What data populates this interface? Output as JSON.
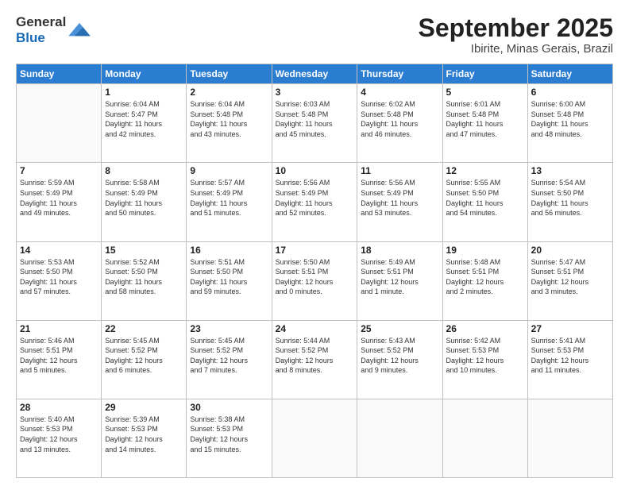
{
  "header": {
    "logo_general": "General",
    "logo_blue": "Blue",
    "month_title": "September 2025",
    "subtitle": "Ibirite, Minas Gerais, Brazil"
  },
  "weekdays": [
    "Sunday",
    "Monday",
    "Tuesday",
    "Wednesday",
    "Thursday",
    "Friday",
    "Saturday"
  ],
  "weeks": [
    [
      {
        "day": "",
        "info": ""
      },
      {
        "day": "1",
        "info": "Sunrise: 6:04 AM\nSunset: 5:47 PM\nDaylight: 11 hours\nand 42 minutes."
      },
      {
        "day": "2",
        "info": "Sunrise: 6:04 AM\nSunset: 5:48 PM\nDaylight: 11 hours\nand 43 minutes."
      },
      {
        "day": "3",
        "info": "Sunrise: 6:03 AM\nSunset: 5:48 PM\nDaylight: 11 hours\nand 45 minutes."
      },
      {
        "day": "4",
        "info": "Sunrise: 6:02 AM\nSunset: 5:48 PM\nDaylight: 11 hours\nand 46 minutes."
      },
      {
        "day": "5",
        "info": "Sunrise: 6:01 AM\nSunset: 5:48 PM\nDaylight: 11 hours\nand 47 minutes."
      },
      {
        "day": "6",
        "info": "Sunrise: 6:00 AM\nSunset: 5:48 PM\nDaylight: 11 hours\nand 48 minutes."
      }
    ],
    [
      {
        "day": "7",
        "info": "Sunrise: 5:59 AM\nSunset: 5:49 PM\nDaylight: 11 hours\nand 49 minutes."
      },
      {
        "day": "8",
        "info": "Sunrise: 5:58 AM\nSunset: 5:49 PM\nDaylight: 11 hours\nand 50 minutes."
      },
      {
        "day": "9",
        "info": "Sunrise: 5:57 AM\nSunset: 5:49 PM\nDaylight: 11 hours\nand 51 minutes."
      },
      {
        "day": "10",
        "info": "Sunrise: 5:56 AM\nSunset: 5:49 PM\nDaylight: 11 hours\nand 52 minutes."
      },
      {
        "day": "11",
        "info": "Sunrise: 5:56 AM\nSunset: 5:49 PM\nDaylight: 11 hours\nand 53 minutes."
      },
      {
        "day": "12",
        "info": "Sunrise: 5:55 AM\nSunset: 5:50 PM\nDaylight: 11 hours\nand 54 minutes."
      },
      {
        "day": "13",
        "info": "Sunrise: 5:54 AM\nSunset: 5:50 PM\nDaylight: 11 hours\nand 56 minutes."
      }
    ],
    [
      {
        "day": "14",
        "info": "Sunrise: 5:53 AM\nSunset: 5:50 PM\nDaylight: 11 hours\nand 57 minutes."
      },
      {
        "day": "15",
        "info": "Sunrise: 5:52 AM\nSunset: 5:50 PM\nDaylight: 11 hours\nand 58 minutes."
      },
      {
        "day": "16",
        "info": "Sunrise: 5:51 AM\nSunset: 5:50 PM\nDaylight: 11 hours\nand 59 minutes."
      },
      {
        "day": "17",
        "info": "Sunrise: 5:50 AM\nSunset: 5:51 PM\nDaylight: 12 hours\nand 0 minutes."
      },
      {
        "day": "18",
        "info": "Sunrise: 5:49 AM\nSunset: 5:51 PM\nDaylight: 12 hours\nand 1 minute."
      },
      {
        "day": "19",
        "info": "Sunrise: 5:48 AM\nSunset: 5:51 PM\nDaylight: 12 hours\nand 2 minutes."
      },
      {
        "day": "20",
        "info": "Sunrise: 5:47 AM\nSunset: 5:51 PM\nDaylight: 12 hours\nand 3 minutes."
      }
    ],
    [
      {
        "day": "21",
        "info": "Sunrise: 5:46 AM\nSunset: 5:51 PM\nDaylight: 12 hours\nand 5 minutes."
      },
      {
        "day": "22",
        "info": "Sunrise: 5:45 AM\nSunset: 5:52 PM\nDaylight: 12 hours\nand 6 minutes."
      },
      {
        "day": "23",
        "info": "Sunrise: 5:45 AM\nSunset: 5:52 PM\nDaylight: 12 hours\nand 7 minutes."
      },
      {
        "day": "24",
        "info": "Sunrise: 5:44 AM\nSunset: 5:52 PM\nDaylight: 12 hours\nand 8 minutes."
      },
      {
        "day": "25",
        "info": "Sunrise: 5:43 AM\nSunset: 5:52 PM\nDaylight: 12 hours\nand 9 minutes."
      },
      {
        "day": "26",
        "info": "Sunrise: 5:42 AM\nSunset: 5:53 PM\nDaylight: 12 hours\nand 10 minutes."
      },
      {
        "day": "27",
        "info": "Sunrise: 5:41 AM\nSunset: 5:53 PM\nDaylight: 12 hours\nand 11 minutes."
      }
    ],
    [
      {
        "day": "28",
        "info": "Sunrise: 5:40 AM\nSunset: 5:53 PM\nDaylight: 12 hours\nand 13 minutes."
      },
      {
        "day": "29",
        "info": "Sunrise: 5:39 AM\nSunset: 5:53 PM\nDaylight: 12 hours\nand 14 minutes."
      },
      {
        "day": "30",
        "info": "Sunrise: 5:38 AM\nSunset: 5:53 PM\nDaylight: 12 hours\nand 15 minutes."
      },
      {
        "day": "",
        "info": ""
      },
      {
        "day": "",
        "info": ""
      },
      {
        "day": "",
        "info": ""
      },
      {
        "day": "",
        "info": ""
      }
    ]
  ]
}
